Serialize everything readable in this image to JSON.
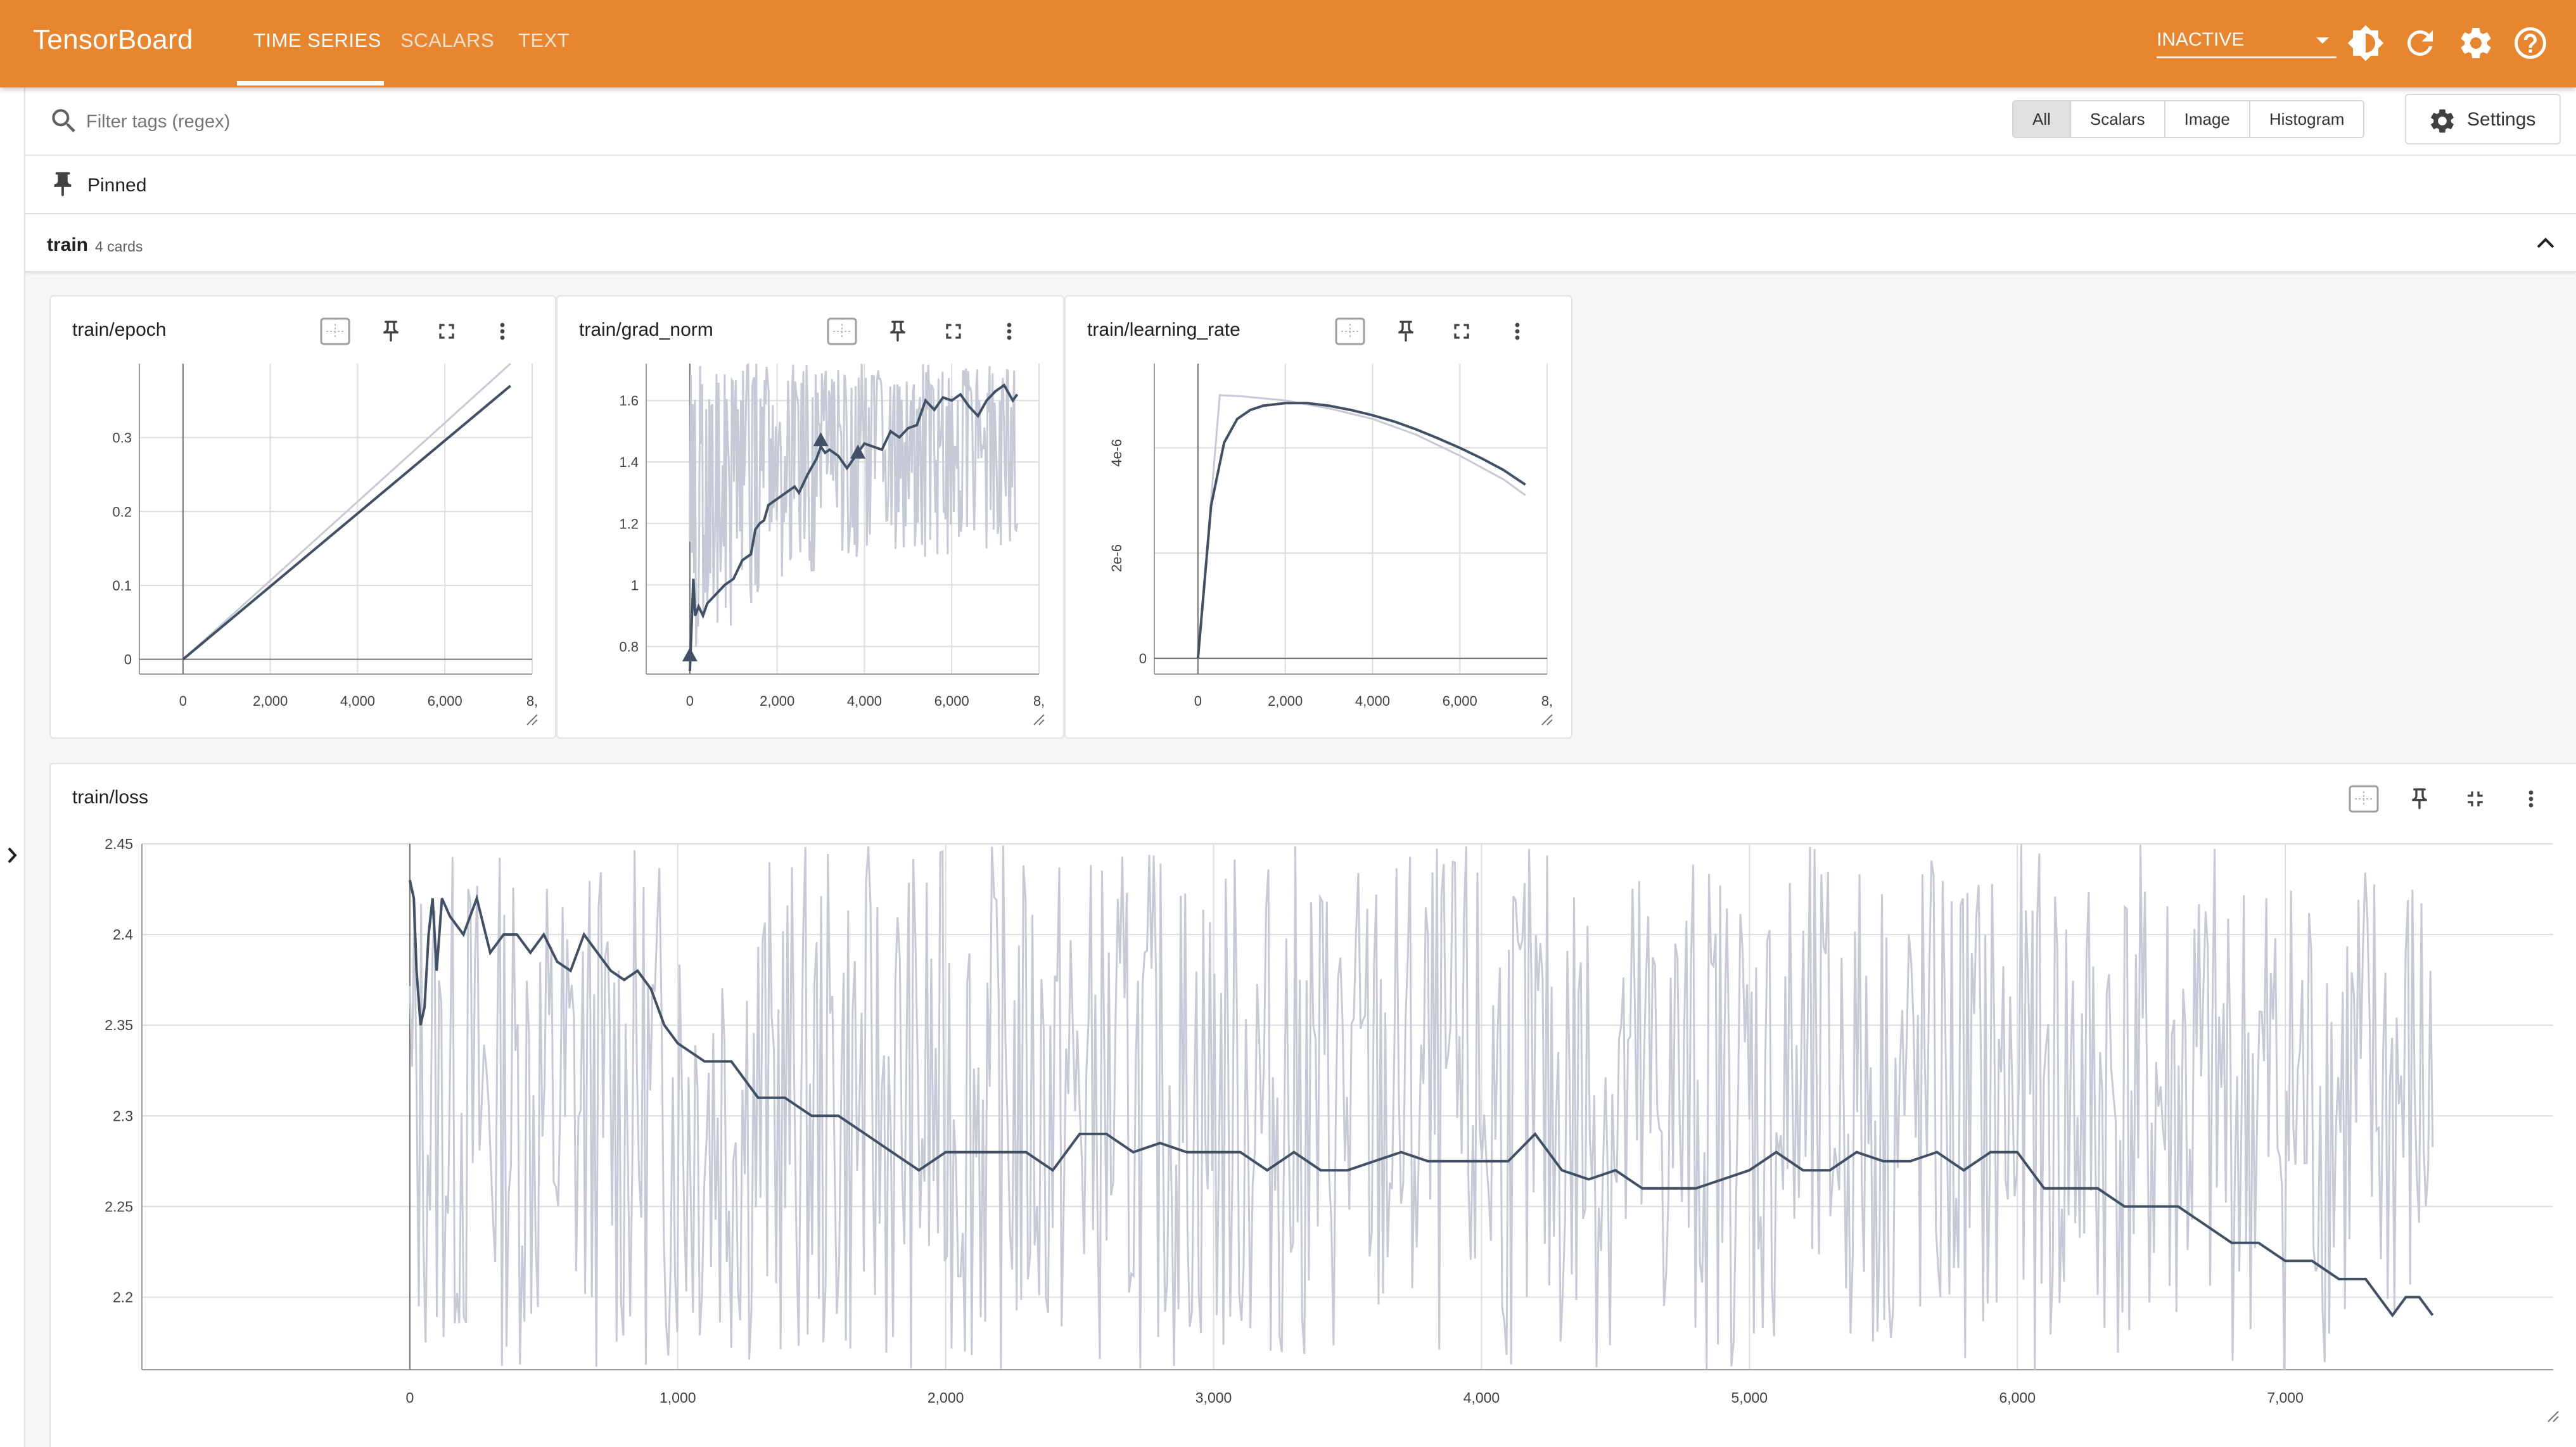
{
  "app": {
    "title": "TensorBoard",
    "tabs": [
      {
        "label": "TIME SERIES",
        "active": true
      },
      {
        "label": "SCALARS",
        "active": false
      },
      {
        "label": "TEXT",
        "active": false
      }
    ],
    "status_select": "INACTIVE",
    "icons": [
      "brightness-icon",
      "refresh-icon",
      "gear-icon",
      "help-icon"
    ]
  },
  "filter": {
    "placeholder": "Filter tags (regex)",
    "types": [
      "All",
      "Scalars",
      "Image",
      "Histogram"
    ],
    "selected_type": "All",
    "settings_label": "Settings"
  },
  "pinned": {
    "label": "Pinned"
  },
  "group": {
    "name": "train",
    "count": "4 cards"
  },
  "colors": {
    "accent": "#e8852f",
    "smoothed": "#425066",
    "raw": "#c5cad6"
  },
  "cards": {
    "epoch": {
      "title": "train/epoch"
    },
    "grad_norm": {
      "title": "train/grad_norm"
    },
    "learning_rate": {
      "title": "train/learning_rate"
    },
    "loss": {
      "title": "train/loss"
    }
  },
  "chart_data": [
    {
      "id": "epoch",
      "type": "line",
      "title": "train/epoch",
      "xlim": [
        -1000,
        8000
      ],
      "ylim": [
        -0.02,
        0.4
      ],
      "xticks": [
        0,
        2000,
        4000,
        6000,
        8000
      ],
      "xtick_labels": [
        "0",
        "2,000",
        "4,000",
        "6,000",
        "8,"
      ],
      "yticks": [
        0,
        0.1,
        0.2,
        0.3
      ],
      "ytick_labels": [
        "0",
        "0.1",
        "0.2",
        "0.3"
      ],
      "series": [
        {
          "role": "raw",
          "x": [
            0,
            7500
          ],
          "y": [
            0,
            0.4
          ]
        },
        {
          "role": "smoothed",
          "x": [
            0,
            7500
          ],
          "y": [
            0,
            0.37
          ]
        }
      ]
    },
    {
      "id": "grad_norm",
      "type": "line",
      "title": "train/grad_norm",
      "xlim": [
        -1000,
        8000
      ],
      "ylim": [
        0.71,
        1.72
      ],
      "xticks": [
        0,
        2000,
        4000,
        6000,
        8000
      ],
      "xtick_labels": [
        "0",
        "2,000",
        "4,000",
        "6,000",
        "8,"
      ],
      "yticks": [
        0.8,
        1,
        1.2,
        1.4,
        1.6
      ],
      "ytick_labels": [
        "0.8",
        "1",
        "1.2",
        "1.4",
        "1.6"
      ],
      "raw_band": {
        "x": [
          0,
          500,
          1000,
          2000,
          3000,
          4000,
          5000,
          6000,
          7000,
          7500
        ],
        "low": [
          0.72,
          0.8,
          0.86,
          0.98,
          1.04,
          1.1,
          1.08,
          1.1,
          1.12,
          1.15
        ],
        "high": [
          1.72,
          1.72,
          1.72,
          1.72,
          1.72,
          1.72,
          1.72,
          1.72,
          1.72,
          1.72
        ]
      },
      "series": [
        {
          "role": "smoothed",
          "x": [
            0,
            80,
            120,
            200,
            300,
            400,
            600,
            800,
            1000,
            1200,
            1400,
            1500,
            1600,
            1700,
            1800,
            2000,
            2200,
            2400,
            2500,
            2700,
            2900,
            3000,
            3100,
            3200,
            3400,
            3600,
            3800,
            4000,
            4200,
            4400,
            4600,
            4800,
            5000,
            5200,
            5400,
            5600,
            5800,
            6000,
            6200,
            6400,
            6600,
            6800,
            7000,
            7200,
            7400,
            7500
          ],
          "y": [
            0.72,
            1.02,
            0.9,
            0.93,
            0.9,
            0.94,
            0.97,
            1.0,
            1.02,
            1.08,
            1.1,
            1.18,
            1.2,
            1.21,
            1.26,
            1.28,
            1.3,
            1.32,
            1.3,
            1.36,
            1.41,
            1.45,
            1.43,
            1.44,
            1.42,
            1.38,
            1.42,
            1.46,
            1.45,
            1.44,
            1.5,
            1.48,
            1.51,
            1.52,
            1.6,
            1.57,
            1.61,
            1.6,
            1.62,
            1.58,
            1.55,
            1.6,
            1.63,
            1.65,
            1.6,
            1.62
          ]
        }
      ],
      "markers": [
        {
          "x": 0,
          "y": 0.77
        },
        {
          "x": 3000,
          "y": 1.47
        },
        {
          "x": 3850,
          "y": 1.43
        }
      ]
    },
    {
      "id": "learning_rate",
      "type": "line",
      "title": "train/learning_rate",
      "xlim": [
        -1000,
        8000
      ],
      "ylim": [
        -3e-07,
        5.6e-06
      ],
      "xticks": [
        0,
        2000,
        4000,
        6000,
        8000
      ],
      "xtick_labels": [
        "0",
        "2,000",
        "4,000",
        "6,000",
        "8,"
      ],
      "yticks": [
        0,
        2e-06,
        4e-06
      ],
      "ytick_labels": [
        "0",
        "2e-6",
        "4e-6"
      ],
      "series": [
        {
          "role": "raw",
          "x": [
            0,
            500,
            1000,
            2000,
            3000,
            4000,
            5000,
            6000,
            7000,
            7500
          ],
          "y": [
            0,
            5e-06,
            4.98e-06,
            4.9e-06,
            4.75e-06,
            4.55e-06,
            4.25e-06,
            3.85e-06,
            3.4e-06,
            3.1e-06
          ]
        },
        {
          "role": "smoothed",
          "x": [
            0,
            300,
            600,
            900,
            1200,
            1500,
            2000,
            2500,
            3000,
            3500,
            4000,
            4500,
            5000,
            5500,
            6000,
            6500,
            7000,
            7500
          ],
          "y": [
            0,
            2.9e-06,
            4.1e-06,
            4.55e-06,
            4.72e-06,
            4.8e-06,
            4.85e-06,
            4.85e-06,
            4.8e-06,
            4.72e-06,
            4.62e-06,
            4.5e-06,
            4.35e-06,
            4.18e-06,
            4e-06,
            3.8e-06,
            3.58e-06,
            3.3e-06
          ]
        }
      ]
    },
    {
      "id": "loss",
      "type": "line",
      "title": "train/loss",
      "xlim": [
        -1000,
        8000
      ],
      "ylim": [
        2.16,
        2.45
      ],
      "xticks": [
        0,
        1000,
        2000,
        3000,
        4000,
        5000,
        6000,
        7000
      ],
      "xtick_labels": [
        "0",
        "1,000",
        "2,000",
        "3,000",
        "4,000",
        "5,000",
        "6,000",
        "7,000"
      ],
      "yticks": [
        2.2,
        2.25,
        2.3,
        2.35,
        2.4,
        2.45
      ],
      "ytick_labels": [
        "2.2",
        "2.25",
        "2.3",
        "2.35",
        "2.4",
        "2.45"
      ],
      "raw_range": {
        "x_start": 0,
        "x_end": 7550,
        "low": 2.16,
        "high": 2.45
      },
      "series": [
        {
          "role": "smoothed",
          "x": [
            0,
            15,
            25,
            40,
            55,
            70,
            85,
            100,
            120,
            150,
            200,
            250,
            300,
            350,
            400,
            450,
            500,
            550,
            600,
            650,
            700,
            750,
            800,
            850,
            900,
            950,
            1000,
            1100,
            1200,
            1300,
            1400,
            1500,
            1600,
            1700,
            1800,
            1900,
            2000,
            2100,
            2200,
            2300,
            2400,
            2500,
            2600,
            2700,
            2800,
            2900,
            3000,
            3100,
            3200,
            3300,
            3400,
            3500,
            3600,
            3700,
            3800,
            3900,
            4000,
            4100,
            4200,
            4300,
            4400,
            4500,
            4600,
            4700,
            4800,
            4900,
            5000,
            5100,
            5200,
            5300,
            5400,
            5500,
            5600,
            5700,
            5800,
            5900,
            6000,
            6100,
            6200,
            6300,
            6400,
            6500,
            6600,
            6700,
            6800,
            6900,
            7000,
            7100,
            7200,
            7300,
            7350,
            7400,
            7450,
            7500,
            7550
          ],
          "y": [
            2.43,
            2.42,
            2.38,
            2.35,
            2.36,
            2.4,
            2.42,
            2.38,
            2.42,
            2.41,
            2.4,
            2.42,
            2.39,
            2.4,
            2.4,
            2.39,
            2.4,
            2.385,
            2.38,
            2.4,
            2.39,
            2.38,
            2.375,
            2.38,
            2.37,
            2.35,
            2.34,
            2.33,
            2.33,
            2.31,
            2.31,
            2.3,
            2.3,
            2.29,
            2.28,
            2.27,
            2.28,
            2.28,
            2.28,
            2.28,
            2.27,
            2.29,
            2.29,
            2.28,
            2.285,
            2.28,
            2.28,
            2.28,
            2.27,
            2.28,
            2.27,
            2.27,
            2.275,
            2.28,
            2.275,
            2.275,
            2.275,
            2.275,
            2.29,
            2.27,
            2.265,
            2.27,
            2.26,
            2.26,
            2.26,
            2.265,
            2.27,
            2.28,
            2.27,
            2.27,
            2.28,
            2.275,
            2.275,
            2.28,
            2.27,
            2.28,
            2.28,
            2.26,
            2.26,
            2.26,
            2.25,
            2.25,
            2.25,
            2.24,
            2.23,
            2.23,
            2.22,
            2.22,
            2.21,
            2.21,
            2.2,
            2.19,
            2.2,
            2.2,
            2.19
          ]
        }
      ]
    }
  ]
}
